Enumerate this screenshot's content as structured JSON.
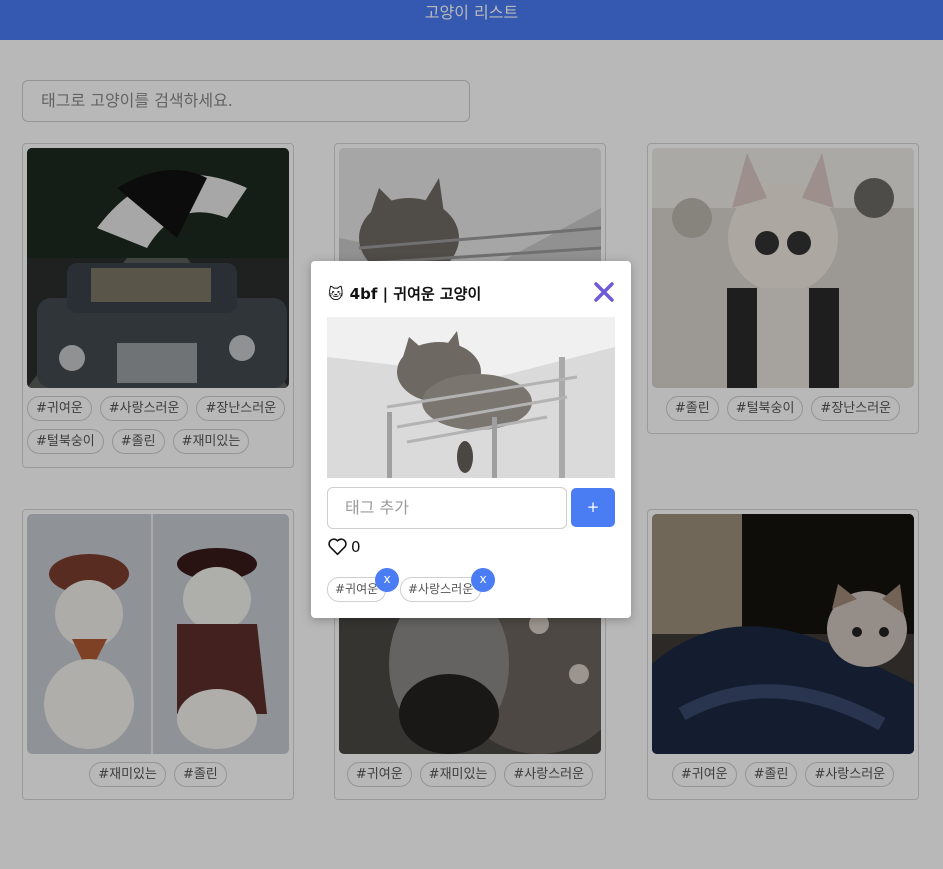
{
  "header": {
    "title": "고양이 리스트"
  },
  "search": {
    "placeholder": "태그로 고양이를 검색하세요."
  },
  "cards": [
    {
      "image": "cat-in-car",
      "tags": [
        "#귀여운",
        "#사랑스러운",
        "#장난스러운",
        "#털북숭이",
        "#졸린",
        "#재미있는"
      ]
    },
    {
      "image": "cat-on-shelf",
      "tags": []
    },
    {
      "image": "cats-on-motorcycles",
      "tags": [
        "#졸린",
        "#털북숭이",
        "#장난스러운"
      ]
    },
    {
      "image": "cats-in-costumes",
      "tags": [
        "#재미있는",
        "#졸린"
      ]
    },
    {
      "image": "cat-on-blanket",
      "tags": [
        "#귀여운",
        "#재미있는",
        "#사랑스러운"
      ]
    },
    {
      "image": "cat-in-clothes",
      "tags": [
        "#귀여운",
        "#졸린",
        "#사랑스러운"
      ]
    }
  ],
  "modal": {
    "emoji": "🐱",
    "title": "4bf | 귀여운 고양이",
    "image": "cat-on-shelf",
    "tag_input_placeholder": "태그 추가",
    "add_label": "+",
    "likes": "0",
    "tags": [
      "#귀여운",
      "#사랑스러운"
    ],
    "remove_label": "x"
  }
}
